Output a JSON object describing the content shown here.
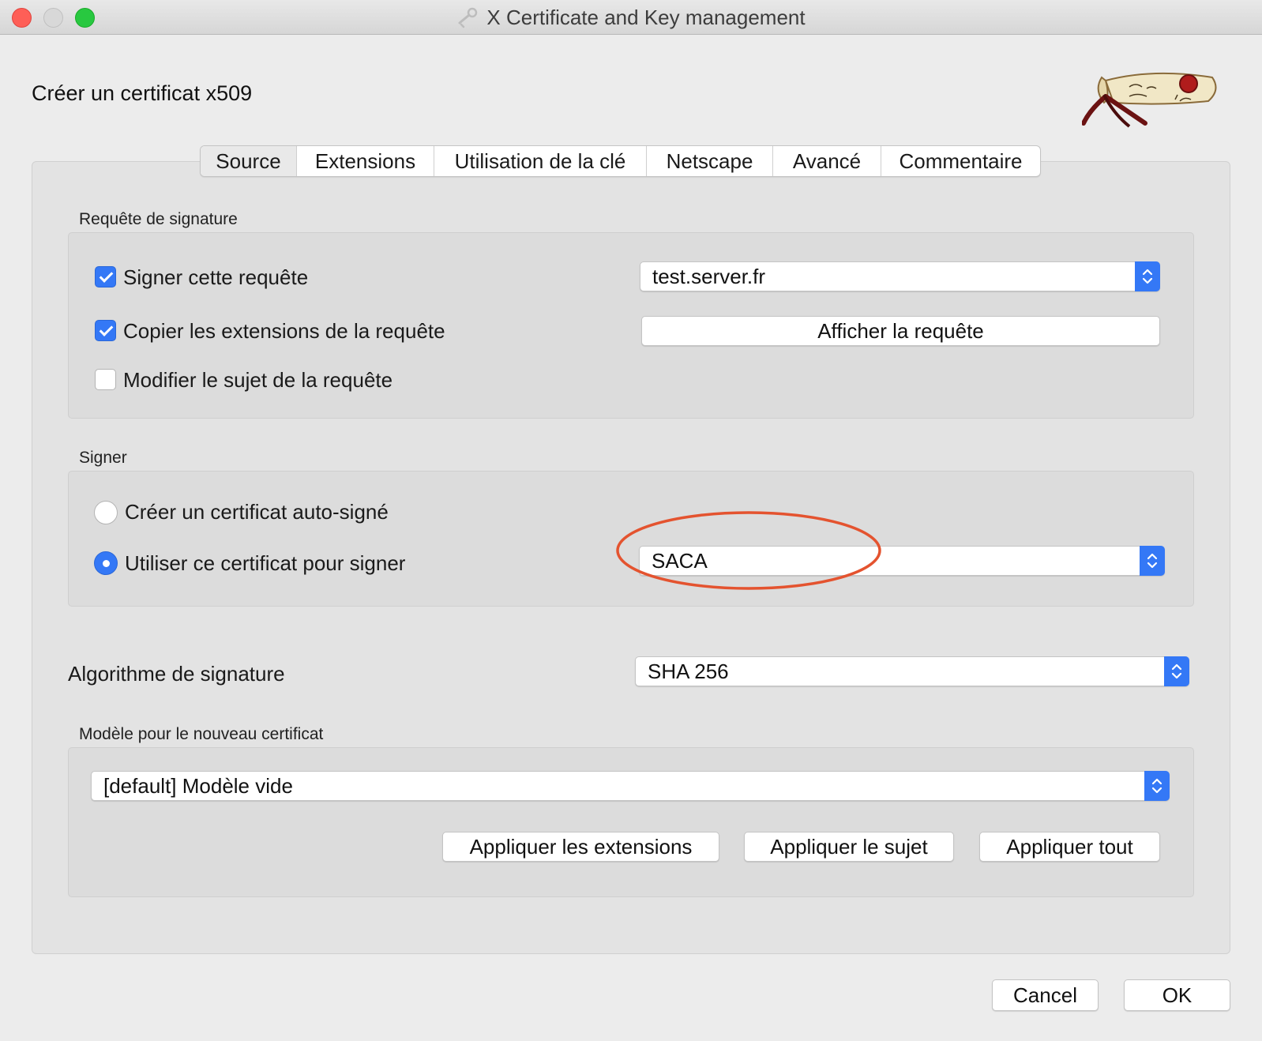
{
  "window": {
    "title": "X Certificate and Key management",
    "app_icon": "xca-icon"
  },
  "dialog": {
    "heading": "Créer un certificat x509",
    "logo": "scroll-logo"
  },
  "tabs": [
    {
      "label": "Source",
      "active": true
    },
    {
      "label": "Extensions",
      "active": false
    },
    {
      "label": "Utilisation de la clé",
      "active": false
    },
    {
      "label": "Netscape",
      "active": false
    },
    {
      "label": "Avancé",
      "active": false
    },
    {
      "label": "Commentaire",
      "active": false
    }
  ],
  "request_group": {
    "label": "Requête de signature",
    "sign_request": {
      "label": "Signer cette requête",
      "checked": true
    },
    "copy_extensions": {
      "label": "Copier les extensions de la requête",
      "checked": true
    },
    "modify_subject": {
      "label": "Modifier le sujet de la requête",
      "checked": false
    },
    "request_select": {
      "value": "test.server.fr"
    },
    "show_request_button": "Afficher la requête"
  },
  "sign_group": {
    "label": "Signer",
    "self_signed": {
      "label": "Créer un certificat auto-signé",
      "selected": false
    },
    "use_cert": {
      "label": "Utiliser ce certificat pour signer",
      "selected": true
    },
    "ca_select": {
      "value": "SACA"
    }
  },
  "algorithm": {
    "label": "Algorithme de signature",
    "value": "SHA 256"
  },
  "template_group": {
    "label": "Modèle pour le nouveau certificat",
    "template_select": {
      "value": "[default] Modèle vide"
    },
    "apply_extensions": "Appliquer les extensions",
    "apply_subject": "Appliquer le sujet",
    "apply_all": "Appliquer tout"
  },
  "footer": {
    "cancel": "Cancel",
    "ok": "OK"
  },
  "colors": {
    "accent": "#3478f6",
    "annotation": "#e4532f",
    "panel": "#e3e3e3"
  }
}
